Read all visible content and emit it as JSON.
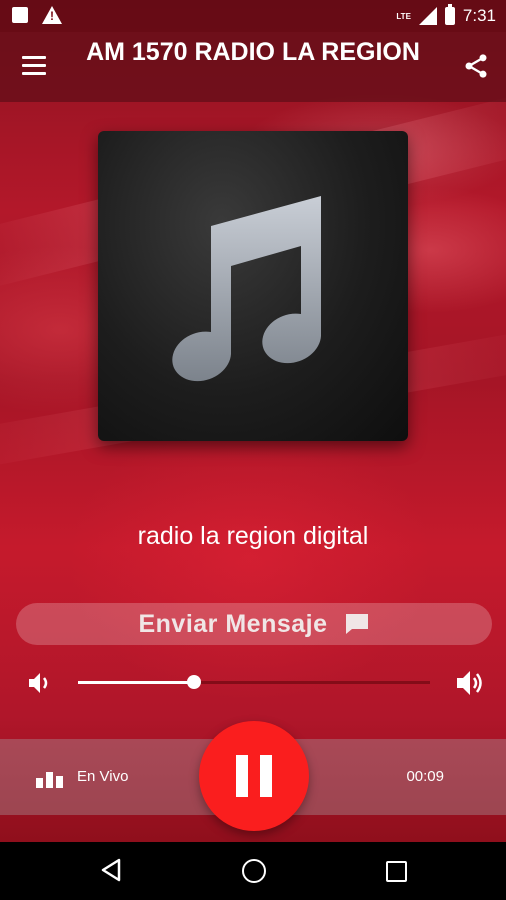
{
  "status_bar": {
    "network": "LTE",
    "time": "7:31"
  },
  "toolbar": {
    "title": "AM 1570 RADIO LA REGION"
  },
  "now_playing": {
    "station_name": "radio la region digital"
  },
  "actions": {
    "send_message_label": "Enviar Mensaje"
  },
  "volume": {
    "level": 0.33
  },
  "player": {
    "live_label": "En Vivo",
    "elapsed_time": "00:09",
    "state": "playing"
  },
  "colors": {
    "accent_red": "#fa1e1e",
    "toolbar": "#5f0e18",
    "background": "#b3182a"
  },
  "icons": {
    "menu": "hamburger-menu-icon",
    "share": "share-icon",
    "album_art": "music-note-icon",
    "chat": "chat-bubble-icon",
    "volume_low": "volume-low-icon",
    "volume_high": "volume-high-icon",
    "live": "bar-chart-icon",
    "pause": "pause-icon"
  }
}
